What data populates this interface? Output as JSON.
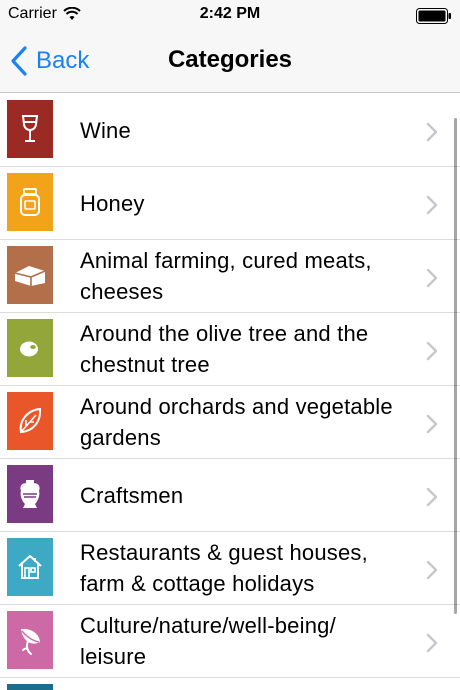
{
  "status_bar": {
    "carrier": "Carrier",
    "time": "2:42 PM"
  },
  "nav": {
    "back_label": "Back",
    "title": "Categories"
  },
  "categories": [
    {
      "label": "Wine",
      "color": "#9b2a25",
      "icon": "wine-glass-icon"
    },
    {
      "label": "Honey",
      "color": "#f3a31a",
      "icon": "honey-jar-icon"
    },
    {
      "label": "Animal farming, cured meats, cheeses",
      "color": "#b26f4a",
      "icon": "cheese-icon"
    },
    {
      "label": "Around the olive tree and the chestnut tree",
      "color": "#93a63a",
      "icon": "olive-icon"
    },
    {
      "label": "Around orchards and vegetable gardens",
      "color": "#e8562a",
      "icon": "leaf-icon"
    },
    {
      "label": "Craftsmen",
      "color": "#7a3b82",
      "icon": "amphora-icon"
    },
    {
      "label": "Restaurants & guest houses, farm & cottage holidays",
      "color": "#3ea9c5",
      "icon": "house-icon"
    },
    {
      "label": "Culture/nature/well-being/ leisure",
      "color": "#cd6aa6",
      "icon": "flower-icon"
    }
  ],
  "partial_row_color": "#1a6e8c",
  "accent_color": "#1a82f5"
}
